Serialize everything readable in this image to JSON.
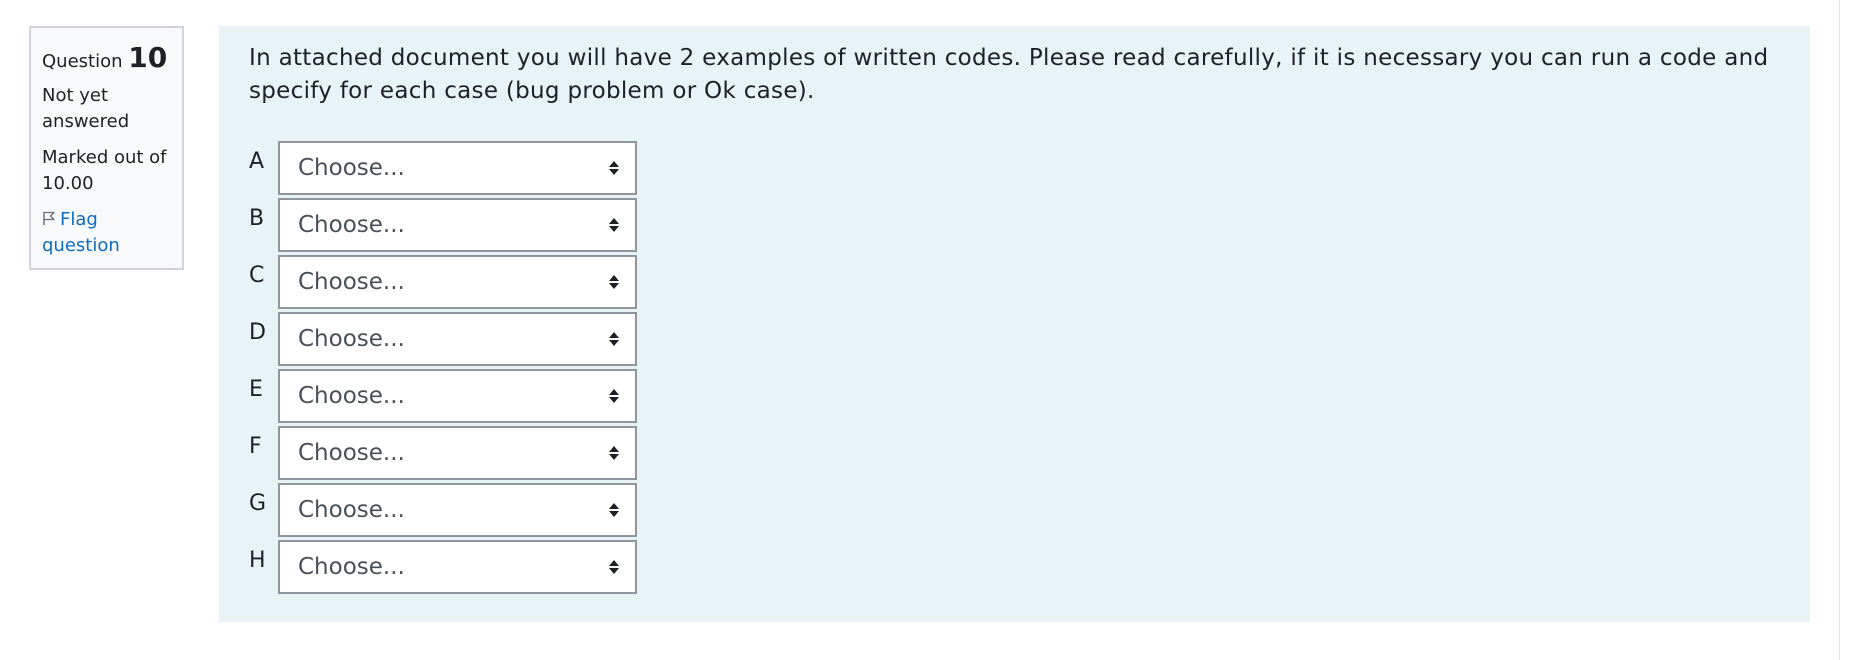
{
  "question": {
    "prefix": "Question",
    "number": "10",
    "status": "Not yet answered",
    "marks": "Marked out of 10.00",
    "flag_label": "Flag question"
  },
  "prompt": "In attached document you will have 2 examples of written codes. Please read carefully, if it is necessary you can run a code and specify for each case (bug problem or Ok case).",
  "rows": [
    {
      "label": "A",
      "value": "Choose..."
    },
    {
      "label": "B",
      "value": "Choose..."
    },
    {
      "label": "C",
      "value": "Choose..."
    },
    {
      "label": "D",
      "value": "Choose..."
    },
    {
      "label": "E",
      "value": "Choose..."
    },
    {
      "label": "F",
      "value": "Choose..."
    },
    {
      "label": "G",
      "value": "Choose..."
    },
    {
      "label": "H",
      "value": "Choose..."
    }
  ],
  "colors": {
    "info_bg": "#f8f9fa",
    "content_bg": "#e7f3f5",
    "link": "#0f6cbf"
  },
  "icons": {
    "flag": "flag-icon",
    "select_caret": "sort-caret-icon"
  }
}
